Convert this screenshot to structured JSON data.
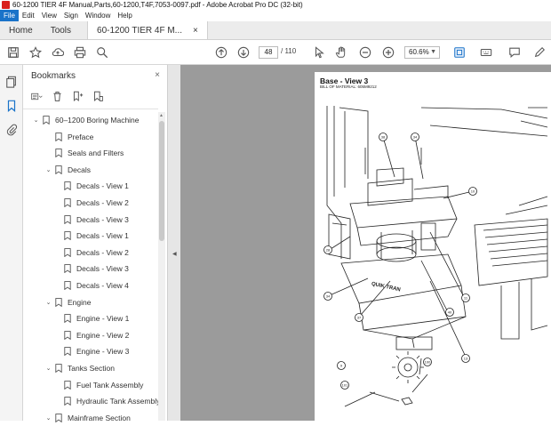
{
  "window": {
    "title": "60-1200 TIER 4F Manual,Parts,60-1200,T4F,7053-0097.pdf - Adobe Acrobat Pro DC (32-bit)"
  },
  "menu": [
    "File",
    "Edit",
    "View",
    "Sign",
    "Window",
    "Help"
  ],
  "tabs": {
    "home": "Home",
    "tools": "Tools",
    "document": "60-1200 TIER 4F M...",
    "close": "×"
  },
  "toolbar": {
    "page_current": "48",
    "page_total": "/ 110",
    "zoom": "60.6%"
  },
  "bookmarks": {
    "header": "Bookmarks",
    "close": "×",
    "items": [
      {
        "label": "60–1200 Boring Machine",
        "level": 0,
        "toggle": "expanded"
      },
      {
        "label": "Preface",
        "level": 1,
        "toggle": "none"
      },
      {
        "label": "Seals and Filters",
        "level": 1,
        "toggle": "none"
      },
      {
        "label": "Decals",
        "level": 1,
        "toggle": "expanded"
      },
      {
        "label": "Decals - View 1",
        "level": 2,
        "toggle": "none"
      },
      {
        "label": "Decals - View 2",
        "level": 2,
        "toggle": "none"
      },
      {
        "label": "Decals - View 3",
        "level": 2,
        "toggle": "none"
      },
      {
        "label": "Decals - View 1",
        "level": 2,
        "toggle": "none"
      },
      {
        "label": "Decals - View 2",
        "level": 2,
        "toggle": "none"
      },
      {
        "label": "Decals - View 3",
        "level": 2,
        "toggle": "none"
      },
      {
        "label": "Decals - View 4",
        "level": 2,
        "toggle": "none"
      },
      {
        "label": "Engine",
        "level": 1,
        "toggle": "expanded"
      },
      {
        "label": "Engine - View 1",
        "level": 2,
        "toggle": "none"
      },
      {
        "label": "Engine - View 2",
        "level": 2,
        "toggle": "none"
      },
      {
        "label": "Engine - View 3",
        "level": 2,
        "toggle": "none"
      },
      {
        "label": "Tanks Section",
        "level": 1,
        "toggle": "expanded"
      },
      {
        "label": "Fuel Tank Assembly",
        "level": 2,
        "toggle": "none"
      },
      {
        "label": "Hydraulic Tank Assembly",
        "level": 2,
        "toggle": "none"
      },
      {
        "label": "Mainframe Section",
        "level": 1,
        "toggle": "expanded"
      }
    ]
  },
  "document_page": {
    "title": "Base - View 3",
    "subtitle": "BILL OF MATERIAL: 605M9212",
    "callouts": [
      "38",
      "34",
      "10",
      "28",
      "34",
      "37",
      "40",
      "11",
      "9",
      "100",
      "101",
      "13"
    ],
    "stencil_text": "QUIK TRAN"
  },
  "colors": {
    "accent": "#1a73c9",
    "app_red": "#d9211c",
    "viewer_bg": "#9b9b9b"
  }
}
